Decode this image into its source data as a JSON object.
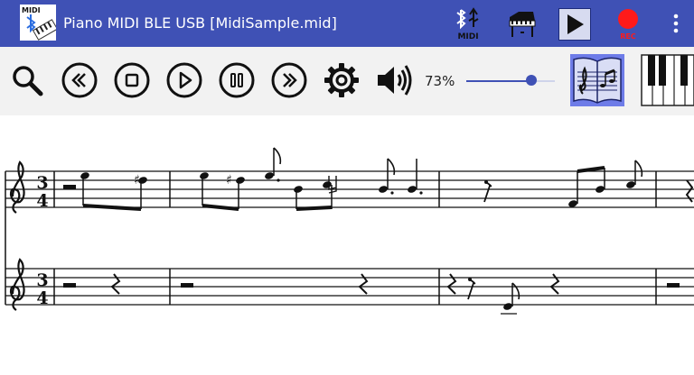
{
  "app": {
    "title": "Piano MIDI BLE USB [MidiSample.mid]",
    "logo_text": "MIDI",
    "colors": {
      "appbar": "#3f51b5",
      "toolbar": "#f2f2f2",
      "accent": "#3f51b5",
      "record": "#ff1a1a",
      "score_toggle_active": "#6e7ce8"
    }
  },
  "appbar_actions": [
    {
      "name": "bluetooth-usb-midi-icon",
      "label": "MIDI"
    },
    {
      "name": "grand-piano-icon"
    },
    {
      "name": "play-icon"
    },
    {
      "name": "record-icon",
      "label": "REC"
    },
    {
      "name": "overflow-menu-icon"
    }
  ],
  "toolbar": {
    "buttons": [
      "search-icon",
      "rewind-icon",
      "stop-icon",
      "play-icon",
      "pause-icon",
      "fast-forward-icon",
      "gear-icon",
      "speaker-icon"
    ],
    "volume_percent_label": "73%",
    "volume_value": 73,
    "view_toggles": [
      {
        "name": "score-view-icon",
        "active": true
      },
      {
        "name": "piano-keyboard-icon",
        "active": false
      }
    ]
  },
  "score": {
    "time_signature": {
      "top": "3",
      "bottom": "4"
    },
    "clefs": [
      "treble-clef",
      "treble-clef"
    ]
  }
}
